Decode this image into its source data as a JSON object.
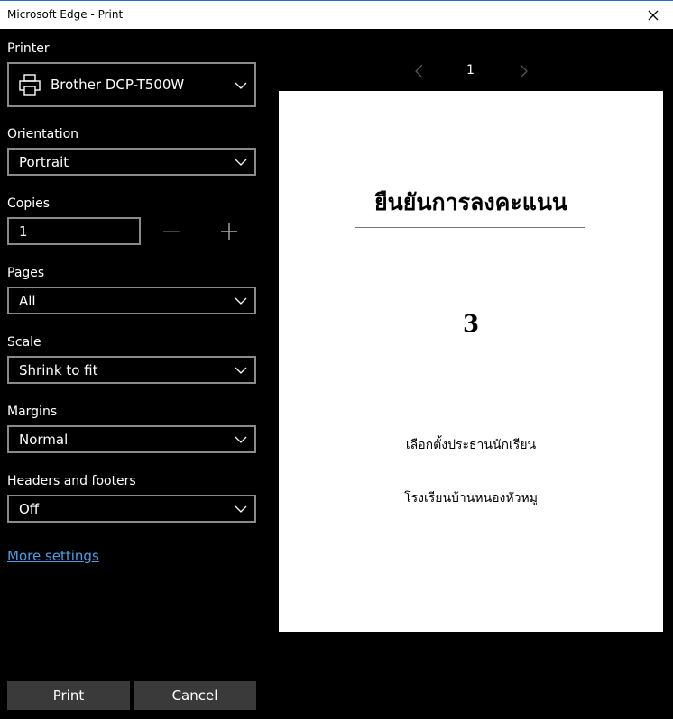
{
  "window": {
    "title": "Microsoft Edge - Print"
  },
  "printer": {
    "label": "Printer",
    "value": "Brother DCP-T500W"
  },
  "orientation": {
    "label": "Orientation",
    "value": "Portrait"
  },
  "copies": {
    "label": "Copies",
    "value": "1"
  },
  "pages": {
    "label": "Pages",
    "value": "All"
  },
  "scale": {
    "label": "Scale",
    "value": "Shrink to fit"
  },
  "margins": {
    "label": "Margins",
    "value": "Normal"
  },
  "headers_footers": {
    "label": "Headers and footers",
    "value": "Off"
  },
  "more_settings": "More settings",
  "buttons": {
    "print": "Print",
    "cancel": "Cancel"
  },
  "preview": {
    "page_number": "1",
    "heading": "ยืนยันการลงคะแนน",
    "big_number": "3",
    "line1": "เลือกตั้งประธานนักเรียน",
    "line2": "โรงเรียนบ้านหนองหัวหมู"
  },
  "colors": {
    "accent": "#4c9de8",
    "background": "#000000",
    "button": "#3a3a3a",
    "border": "#8a8a8a"
  }
}
